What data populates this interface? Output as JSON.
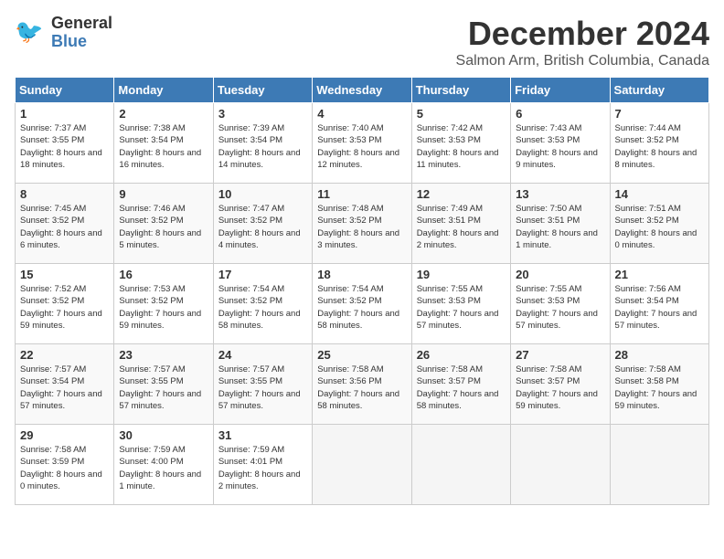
{
  "header": {
    "logo_line1": "General",
    "logo_line2": "Blue",
    "month_title": "December 2024",
    "location": "Salmon Arm, British Columbia, Canada"
  },
  "weekdays": [
    "Sunday",
    "Monday",
    "Tuesday",
    "Wednesday",
    "Thursday",
    "Friday",
    "Saturday"
  ],
  "weeks": [
    [
      {
        "day": "1",
        "sunrise": "Sunrise: 7:37 AM",
        "sunset": "Sunset: 3:55 PM",
        "daylight": "Daylight: 8 hours and 18 minutes."
      },
      {
        "day": "2",
        "sunrise": "Sunrise: 7:38 AM",
        "sunset": "Sunset: 3:54 PM",
        "daylight": "Daylight: 8 hours and 16 minutes."
      },
      {
        "day": "3",
        "sunrise": "Sunrise: 7:39 AM",
        "sunset": "Sunset: 3:54 PM",
        "daylight": "Daylight: 8 hours and 14 minutes."
      },
      {
        "day": "4",
        "sunrise": "Sunrise: 7:40 AM",
        "sunset": "Sunset: 3:53 PM",
        "daylight": "Daylight: 8 hours and 12 minutes."
      },
      {
        "day": "5",
        "sunrise": "Sunrise: 7:42 AM",
        "sunset": "Sunset: 3:53 PM",
        "daylight": "Daylight: 8 hours and 11 minutes."
      },
      {
        "day": "6",
        "sunrise": "Sunrise: 7:43 AM",
        "sunset": "Sunset: 3:53 PM",
        "daylight": "Daylight: 8 hours and 9 minutes."
      },
      {
        "day": "7",
        "sunrise": "Sunrise: 7:44 AM",
        "sunset": "Sunset: 3:52 PM",
        "daylight": "Daylight: 8 hours and 8 minutes."
      }
    ],
    [
      {
        "day": "8",
        "sunrise": "Sunrise: 7:45 AM",
        "sunset": "Sunset: 3:52 PM",
        "daylight": "Daylight: 8 hours and 6 minutes."
      },
      {
        "day": "9",
        "sunrise": "Sunrise: 7:46 AM",
        "sunset": "Sunset: 3:52 PM",
        "daylight": "Daylight: 8 hours and 5 minutes."
      },
      {
        "day": "10",
        "sunrise": "Sunrise: 7:47 AM",
        "sunset": "Sunset: 3:52 PM",
        "daylight": "Daylight: 8 hours and 4 minutes."
      },
      {
        "day": "11",
        "sunrise": "Sunrise: 7:48 AM",
        "sunset": "Sunset: 3:52 PM",
        "daylight": "Daylight: 8 hours and 3 minutes."
      },
      {
        "day": "12",
        "sunrise": "Sunrise: 7:49 AM",
        "sunset": "Sunset: 3:51 PM",
        "daylight": "Daylight: 8 hours and 2 minutes."
      },
      {
        "day": "13",
        "sunrise": "Sunrise: 7:50 AM",
        "sunset": "Sunset: 3:51 PM",
        "daylight": "Daylight: 8 hours and 1 minute."
      },
      {
        "day": "14",
        "sunrise": "Sunrise: 7:51 AM",
        "sunset": "Sunset: 3:52 PM",
        "daylight": "Daylight: 8 hours and 0 minutes."
      }
    ],
    [
      {
        "day": "15",
        "sunrise": "Sunrise: 7:52 AM",
        "sunset": "Sunset: 3:52 PM",
        "daylight": "Daylight: 7 hours and 59 minutes."
      },
      {
        "day": "16",
        "sunrise": "Sunrise: 7:53 AM",
        "sunset": "Sunset: 3:52 PM",
        "daylight": "Daylight: 7 hours and 59 minutes."
      },
      {
        "day": "17",
        "sunrise": "Sunrise: 7:54 AM",
        "sunset": "Sunset: 3:52 PM",
        "daylight": "Daylight: 7 hours and 58 minutes."
      },
      {
        "day": "18",
        "sunrise": "Sunrise: 7:54 AM",
        "sunset": "Sunset: 3:52 PM",
        "daylight": "Daylight: 7 hours and 58 minutes."
      },
      {
        "day": "19",
        "sunrise": "Sunrise: 7:55 AM",
        "sunset": "Sunset: 3:53 PM",
        "daylight": "Daylight: 7 hours and 57 minutes."
      },
      {
        "day": "20",
        "sunrise": "Sunrise: 7:55 AM",
        "sunset": "Sunset: 3:53 PM",
        "daylight": "Daylight: 7 hours and 57 minutes."
      },
      {
        "day": "21",
        "sunrise": "Sunrise: 7:56 AM",
        "sunset": "Sunset: 3:54 PM",
        "daylight": "Daylight: 7 hours and 57 minutes."
      }
    ],
    [
      {
        "day": "22",
        "sunrise": "Sunrise: 7:57 AM",
        "sunset": "Sunset: 3:54 PM",
        "daylight": "Daylight: 7 hours and 57 minutes."
      },
      {
        "day": "23",
        "sunrise": "Sunrise: 7:57 AM",
        "sunset": "Sunset: 3:55 PM",
        "daylight": "Daylight: 7 hours and 57 minutes."
      },
      {
        "day": "24",
        "sunrise": "Sunrise: 7:57 AM",
        "sunset": "Sunset: 3:55 PM",
        "daylight": "Daylight: 7 hours and 57 minutes."
      },
      {
        "day": "25",
        "sunrise": "Sunrise: 7:58 AM",
        "sunset": "Sunset: 3:56 PM",
        "daylight": "Daylight: 7 hours and 58 minutes."
      },
      {
        "day": "26",
        "sunrise": "Sunrise: 7:58 AM",
        "sunset": "Sunset: 3:57 PM",
        "daylight": "Daylight: 7 hours and 58 minutes."
      },
      {
        "day": "27",
        "sunrise": "Sunrise: 7:58 AM",
        "sunset": "Sunset: 3:57 PM",
        "daylight": "Daylight: 7 hours and 59 minutes."
      },
      {
        "day": "28",
        "sunrise": "Sunrise: 7:58 AM",
        "sunset": "Sunset: 3:58 PM",
        "daylight": "Daylight: 7 hours and 59 minutes."
      }
    ],
    [
      {
        "day": "29",
        "sunrise": "Sunrise: 7:58 AM",
        "sunset": "Sunset: 3:59 PM",
        "daylight": "Daylight: 8 hours and 0 minutes."
      },
      {
        "day": "30",
        "sunrise": "Sunrise: 7:59 AM",
        "sunset": "Sunset: 4:00 PM",
        "daylight": "Daylight: 8 hours and 1 minute."
      },
      {
        "day": "31",
        "sunrise": "Sunrise: 7:59 AM",
        "sunset": "Sunset: 4:01 PM",
        "daylight": "Daylight: 8 hours and 2 minutes."
      },
      null,
      null,
      null,
      null
    ]
  ]
}
